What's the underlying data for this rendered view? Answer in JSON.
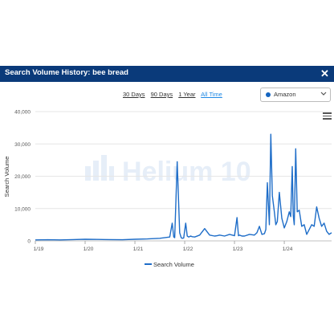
{
  "modal": {
    "title": "Search Volume History: bee bread",
    "close_icon": "close-icon"
  },
  "ranges": [
    {
      "label": "30 Days",
      "active": false
    },
    {
      "label": "90 Days",
      "active": false
    },
    {
      "label": "1 Year",
      "active": false
    },
    {
      "label": "All Time",
      "active": true
    }
  ],
  "marketplace": {
    "selected": "Amazon",
    "dot_color": "#1565c0"
  },
  "watermark": "Helium 10",
  "colors": {
    "header": "#0a3a7a",
    "series": "#1e6dc8",
    "accent": "#1e88e5"
  },
  "chart_data": {
    "type": "line",
    "ylabel": "Search Volume",
    "xlabel": "",
    "ylim": [
      0,
      40000
    ],
    "yticks": [
      0,
      10000,
      20000,
      30000,
      40000
    ],
    "ytick_labels": [
      "0",
      "10,000",
      "20,000",
      "30,000",
      "40,000"
    ],
    "xlim": [
      2019.0,
      2024.95
    ],
    "xticks": [
      2019.0,
      2020.0,
      2021.0,
      2022.0,
      2023.0,
      2024.0
    ],
    "xtick_labels": [
      "1/19",
      "1/20",
      "1/21",
      "1/22",
      "1/23",
      "1/24"
    ],
    "grid": true,
    "legend": "bottom-center",
    "series": [
      {
        "name": "Search Volume",
        "x": [
          2019.0,
          2019.25,
          2019.5,
          2019.75,
          2020.0,
          2020.25,
          2020.5,
          2020.75,
          2021.0,
          2021.25,
          2021.5,
          2021.7,
          2021.75,
          2021.78,
          2021.8,
          2021.85,
          2021.9,
          2021.93,
          2021.95,
          2021.98,
          2022.02,
          2022.05,
          2022.08,
          2022.12,
          2022.15,
          2022.2,
          2022.3,
          2022.4,
          2022.5,
          2022.6,
          2022.65,
          2022.7,
          2022.8,
          2022.9,
          2023.0,
          2023.05,
          2023.08,
          2023.1,
          2023.15,
          2023.2,
          2023.3,
          2023.4,
          2023.45,
          2023.5,
          2023.55,
          2023.6,
          2023.63,
          2023.66,
          2023.7,
          2023.73,
          2023.76,
          2023.8,
          2023.83,
          2023.86,
          2023.9,
          2023.95,
          2024.0,
          2024.05,
          2024.1,
          2024.13,
          2024.16,
          2024.18,
          2024.2,
          2024.23,
          2024.26,
          2024.3,
          2024.35,
          2024.4,
          2024.45,
          2024.5,
          2024.55,
          2024.6,
          2024.65,
          2024.7,
          2024.75,
          2024.8,
          2024.85,
          2024.9,
          2024.95
        ],
        "values": [
          300,
          350,
          300,
          400,
          500,
          450,
          400,
          350,
          500,
          600,
          800,
          1200,
          5500,
          1200,
          1000,
          24500,
          2500,
          1000,
          800,
          900,
          5500,
          1500,
          1200,
          1500,
          1300,
          1200,
          1800,
          3800,
          1800,
          1500,
          1600,
          1800,
          1500,
          2000,
          1600,
          7200,
          1600,
          1800,
          1500,
          1500,
          2000,
          1800,
          2500,
          4500,
          2000,
          2200,
          3500,
          18000,
          5000,
          33000,
          14000,
          9000,
          5000,
          6000,
          15000,
          7000,
          4000,
          6000,
          9000,
          7500,
          23000,
          8000,
          5000,
          28500,
          9000,
          9500,
          4500,
          5000,
          2000,
          3500,
          5000,
          4500,
          10500,
          7000,
          4500,
          5500,
          3000,
          2000,
          2500
        ]
      }
    ]
  }
}
